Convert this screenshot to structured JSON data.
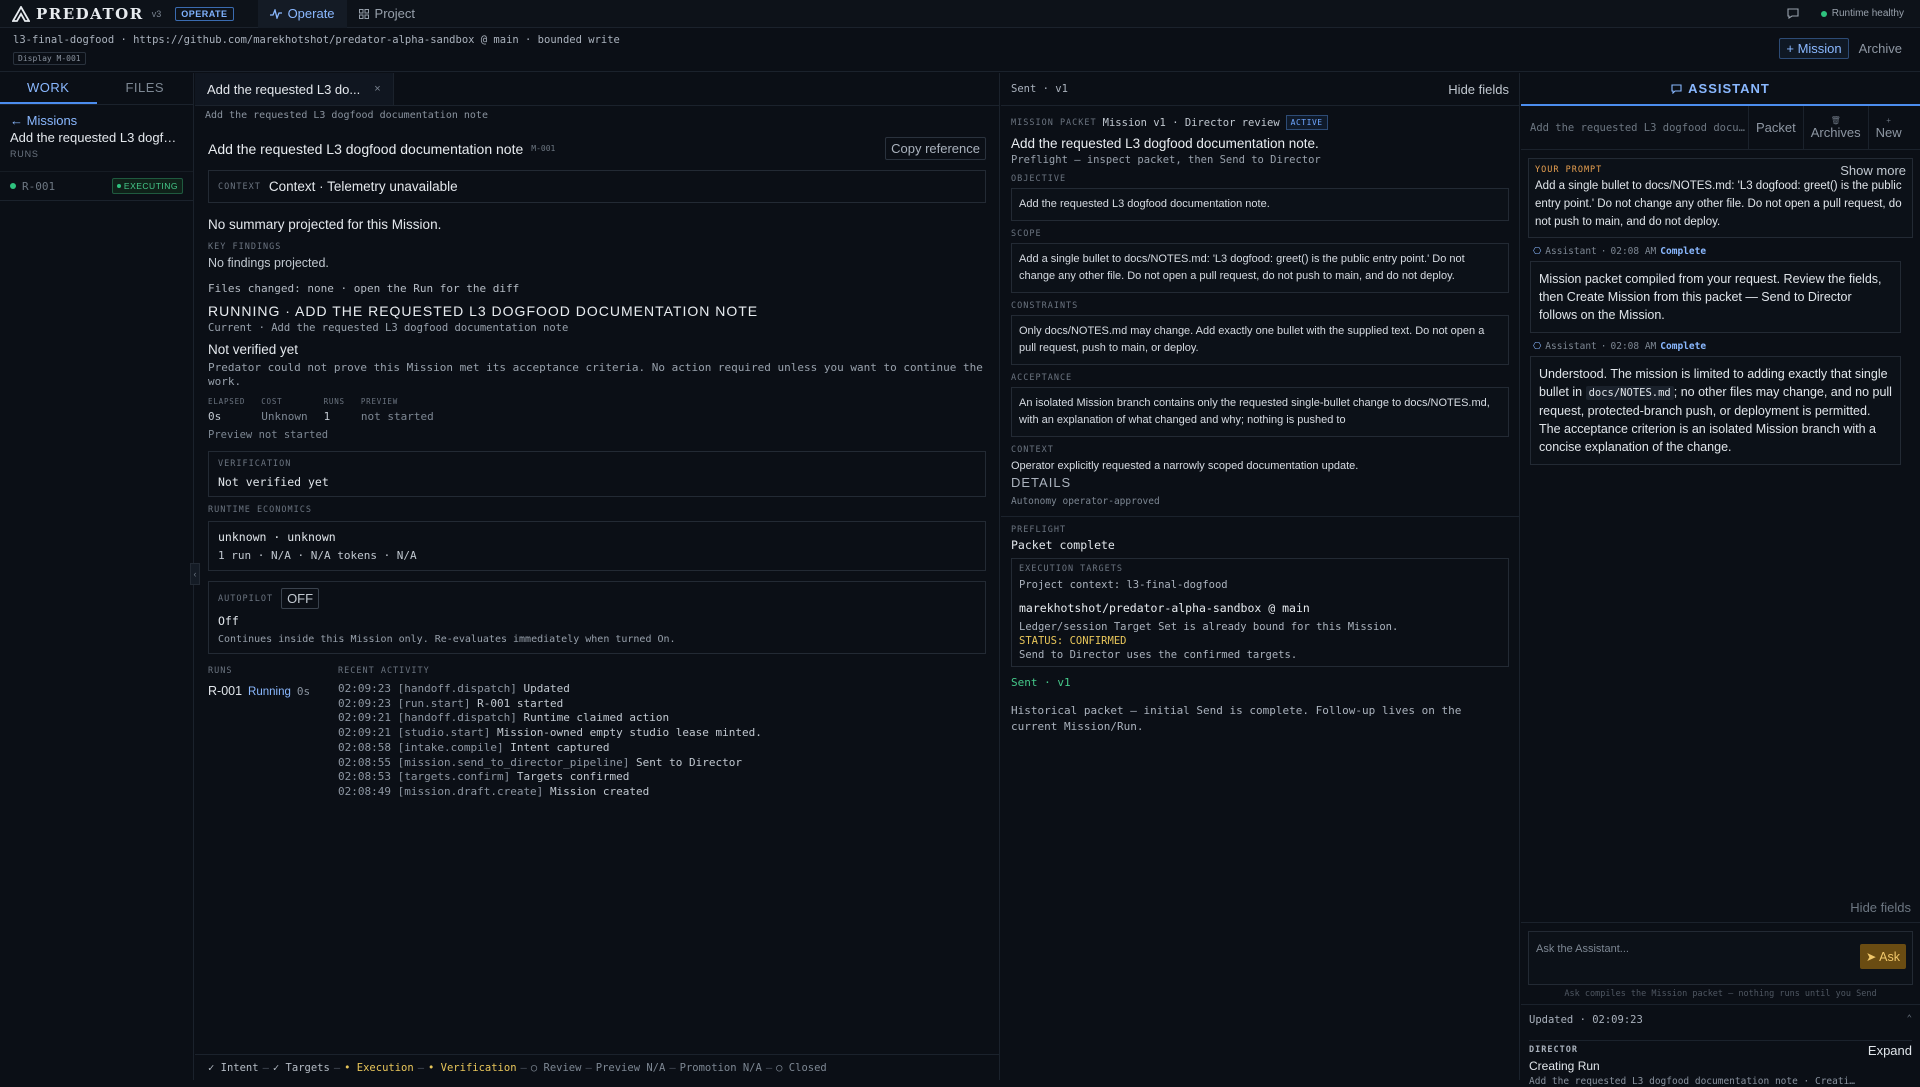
{
  "app": {
    "name": "PREDATOR",
    "version": "v3",
    "mode_badge": "OPERATE",
    "tabs": [
      {
        "label": "Operate",
        "icon": "pulse-icon",
        "active": true
      },
      {
        "label": "Project",
        "icon": "grid-icon",
        "active": false
      }
    ],
    "runtime_status": "Runtime healthy",
    "accent": "#4c8dee"
  },
  "context_bar": {
    "line": "l3-final-dogfood · https://github.com/marekhotshot/predator-alpha-sandbox @ main · bounded write",
    "display_badge": "Display M-001",
    "mission_button": "+ Mission",
    "archive_button": "Archive"
  },
  "sidebar": {
    "tabs": [
      "WORK",
      "FILES"
    ],
    "back_label": "← Missions",
    "mission_title": "Add the requested L3 dogfoo...",
    "runs_label": "RUNS",
    "runs": [
      {
        "id": "R-001",
        "status": "EXECUTING"
      }
    ]
  },
  "main": {
    "tab_label": "Add the requested L3 do...",
    "tab_close": "×",
    "breadcrumb": "Add the requested L3 dogfood documentation note",
    "title": "Add the requested L3 dogfood documentation note",
    "code": "M-001",
    "copy_button": "Copy reference",
    "context_label": "CONTEXT",
    "context_text": "Context · Telemetry unavailable",
    "summary": "No summary projected for this Mission.",
    "key_findings_label": "KEY FINDINGS",
    "key_findings": "No findings projected.",
    "files_changed": "Files changed: none · open the Run for the diff",
    "running_title": "RUNNING · ADD THE REQUESTED L3 DOGFOOD DOCUMENTATION NOTE",
    "current_line": "Current · Add the requested L3 dogfood documentation note",
    "not_verified_title": "Not verified yet",
    "not_verified_desc": "Predator could not prove this Mission met its acceptance criteria. No action required unless you want to continue the work.",
    "stats": [
      {
        "label": "ELAPSED",
        "value": "0s"
      },
      {
        "label": "COST",
        "value": "Unknown"
      },
      {
        "label": "RUNS",
        "value": "1"
      },
      {
        "label": "PREVIEW",
        "value": "not started"
      }
    ],
    "preview_status": "Preview not started",
    "verification_label": "VERIFICATION",
    "verification_value": "Not verified yet",
    "economics_label": "RUNTIME ECONOMICS",
    "economics_line1": "unknown · unknown",
    "economics_line2": "1 run · N/A · N/A tokens · N/A",
    "autopilot_label": "AUTOPILOT",
    "autopilot_button": "OFF",
    "autopilot_value": "Off",
    "autopilot_desc": "Continues inside this Mission only. Re-evaluates immediately when turned On.",
    "runs_label": "RUNS",
    "activity_label": "RECENT ACTIVITY",
    "run_rows": [
      {
        "id": "R-001",
        "status": "Running",
        "elapsed": "0s"
      }
    ],
    "activity": [
      {
        "time": "02:09:23",
        "action": "[handoff.dispatch]",
        "text": "Updated"
      },
      {
        "time": "02:09:23",
        "action": "[run.start]",
        "text": "R-001 started"
      },
      {
        "time": "02:09:21",
        "action": "[handoff.dispatch]",
        "text": "Runtime claimed action"
      },
      {
        "time": "02:09:21",
        "action": "[studio.start]",
        "text": "Mission-owned empty studio lease minted."
      },
      {
        "time": "02:08:58",
        "action": "[intake.compile]",
        "text": "Intent captured"
      },
      {
        "time": "02:08:55",
        "action": "[mission.send_to_director_pipeline]",
        "text": "Sent to Director"
      },
      {
        "time": "02:08:53",
        "action": "[targets.confirm]",
        "text": "Targets confirmed"
      },
      {
        "time": "02:08:49",
        "action": "[mission.draft.create]",
        "text": "Mission created"
      }
    ],
    "pipeline": [
      {
        "label": "✓ Intent",
        "state": "done"
      },
      {
        "label": "✓ Targets",
        "state": "done"
      },
      {
        "label": "• Execution",
        "state": "active"
      },
      {
        "label": "• Verification",
        "state": "active"
      },
      {
        "label": "○ Review",
        "state": "pending"
      },
      {
        "label": "Preview N/A",
        "state": "pending"
      },
      {
        "label": "Promotion N/A",
        "state": "pending"
      },
      {
        "label": "○ Closed",
        "state": "pending"
      }
    ]
  },
  "packet": {
    "sent_label": "Sent · v1",
    "hide_fields": "Hide fields",
    "packet_label": "MISSION PACKET",
    "packet_meta": "Mission v1 · Director review",
    "active_badge": "ACTIVE",
    "title": "Add the requested L3 dogfood documentation note.",
    "preflight_hint": "Preflight — inspect packet, then Send to Director",
    "objective_label": "OBJECTIVE",
    "objective": "Add the requested L3 dogfood documentation note.",
    "scope_label": "SCOPE",
    "scope": "Add a single bullet to docs/NOTES.md: 'L3 dogfood: greet() is the public entry point.' Do not change any other file. Do not open a pull request, do not push to main, and do not deploy.",
    "constraints_label": "CONSTRAINTS",
    "constraints": "Only docs/NOTES.md may change. Add exactly one bullet with the supplied text. Do not open a pull request, push to main, or deploy.",
    "acceptance_label": "ACCEPTANCE",
    "acceptance": "An isolated Mission branch contains only the requested single-bullet change to docs/NOTES.md, with an explanation of what changed and why; nothing is pushed to",
    "context_label": "CONTEXT",
    "context": "Operator explicitly requested a narrowly scoped documentation update.",
    "details": "DETAILS",
    "autonomy": "Autonomy operator-approved",
    "preflight_label": "PREFLIGHT",
    "preflight": "Packet complete",
    "exec_label": "EXECUTION TARGETS",
    "project_context": "Project context: l3-final-dogfood",
    "repo": "marekhotshot/predator-alpha-sandbox @ main",
    "ledger": "Ledger/session Target Set is already bound for this Mission.",
    "status": "STATUS: CONFIRMED",
    "send_note": "Send to Director uses the confirmed targets.",
    "sent_version": "Sent · v1",
    "historical": "Historical packet — initial Send is complete. Follow-up lives on the current Mission/Run."
  },
  "assistant": {
    "title": "ASSISTANT",
    "prompt_name": "Add the requested L3 dogfood docume...",
    "packet_button": "Packet",
    "archives_button": "Archives",
    "new_button": "New",
    "your_prompt_label": "YOUR PROMPT",
    "show_more": "Show more",
    "prompt_text": "Add a single bullet to docs/NOTES.md: 'L3 dogfood: greet() is the public entry point.' Do not change any other file. Do not open a pull request, do not push to main, and do not deploy.",
    "messages": [
      {
        "author": "Assistant",
        "time": "02:08 AM",
        "status": "Complete",
        "text": "Mission packet compiled from your request. Review the fields, then Create Mission from this packet — Send to Director follows on the Mission."
      },
      {
        "author": "Assistant",
        "time": "02:08 AM",
        "status": "Complete",
        "text_before": "Understood. The mission is limited to adding exactly that single bullet in",
        "code": "docs/NOTES.md",
        "text_after": "; no other files may change, and no pull request, protected-branch push, or deployment is permitted. The acceptance criterion is an isolated Mission branch with a concise explanation of the change."
      }
    ],
    "hide_fields": "Hide fields",
    "input_placeholder": "Ask the Assistant...",
    "ask_button": "Ask",
    "ask_hint": "Ask compiles the Mission packet — nothing runs until you Send",
    "updated": "Updated · 02:09:23",
    "director_label": "DIRECTOR",
    "expand": "Expand",
    "director_state": "Creating Run",
    "director_desc": "Add the requested L3 dogfood documentation note · Creating ..."
  }
}
